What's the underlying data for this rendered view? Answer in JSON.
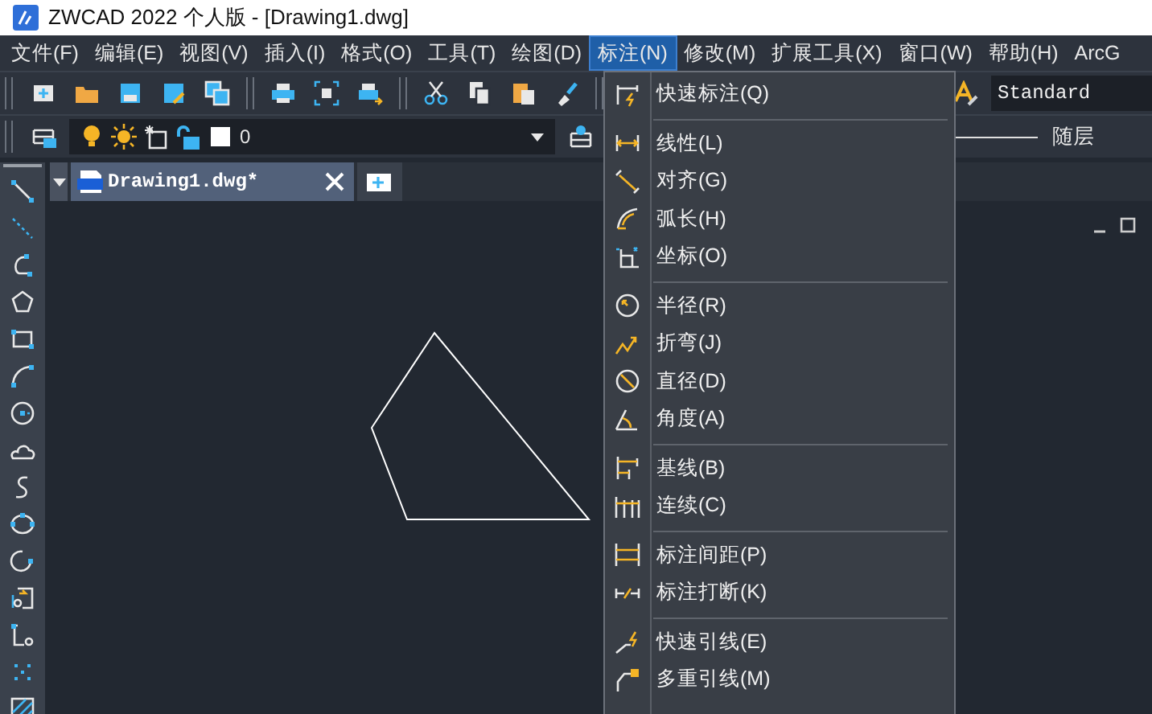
{
  "window": {
    "title": "ZWCAD 2022 个人版 - [Drawing1.dwg]"
  },
  "menu_bar": [
    {
      "label": "文件(F)",
      "selected": false
    },
    {
      "label": "编辑(E)",
      "selected": false
    },
    {
      "label": "视图(V)",
      "selected": false
    },
    {
      "label": "插入(I)",
      "selected": false
    },
    {
      "label": "格式(O)",
      "selected": false
    },
    {
      "label": "工具(T)",
      "selected": false
    },
    {
      "label": "绘图(D)",
      "selected": false
    },
    {
      "label": "标注(N)",
      "selected": true
    },
    {
      "label": "修改(M)",
      "selected": false
    },
    {
      "label": "扩展工具(X)",
      "selected": false
    },
    {
      "label": "窗口(W)",
      "selected": false
    },
    {
      "label": "帮助(H)",
      "selected": false
    },
    {
      "label": "ArcG",
      "selected": false
    }
  ],
  "layer_toolbar": {
    "layer": "0",
    "text_style": "Standard",
    "linetype": "随层"
  },
  "document_tabs": [
    {
      "label": "Drawing1.dwg*",
      "selected": true
    }
  ],
  "dropdown_menu": {
    "groups": [
      [
        {
          "label": "快速标注(Q)"
        }
      ],
      [
        {
          "label": "线性(L)"
        },
        {
          "label": "对齐(G)"
        },
        {
          "label": "弧长(H)"
        },
        {
          "label": "坐标(O)"
        }
      ],
      [
        {
          "label": "半径(R)"
        },
        {
          "label": "折弯(J)"
        },
        {
          "label": "直径(D)"
        },
        {
          "label": "角度(A)"
        }
      ],
      [
        {
          "label": "基线(B)"
        },
        {
          "label": "连续(C)"
        }
      ],
      [
        {
          "label": "标注间距(P)"
        },
        {
          "label": "标注打断(K)"
        }
      ],
      [
        {
          "label": "快速引线(E)"
        },
        {
          "label": "多重引线(M)"
        }
      ]
    ]
  }
}
